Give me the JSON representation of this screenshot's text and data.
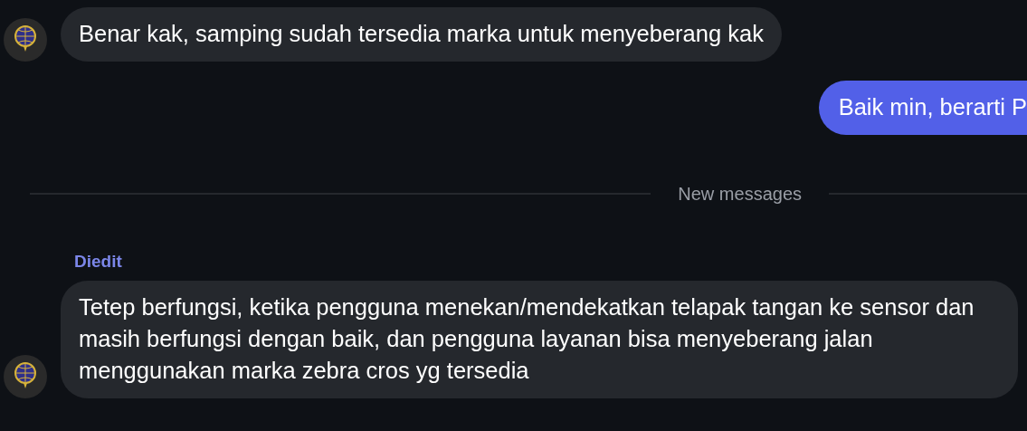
{
  "messages": [
    {
      "kind": "incoming",
      "avatar": true,
      "text": "Benar kak, samping sudah tersedia marka untuk menyeberang kak"
    },
    {
      "kind": "outgoing",
      "text": "Baik min, berarti P"
    },
    {
      "kind": "divider",
      "text": "New messages"
    },
    {
      "kind": "incoming",
      "avatar": true,
      "sender": "Diedit",
      "text": "Tetep berfungsi, ketika pengguna menekan/mendekatkan telapak tangan ke sensor dan masih berfungsi dengan baik, dan pengguna layanan bisa menyeberang jalan menggunakan marka zebra cros yg tersedia"
    }
  ]
}
